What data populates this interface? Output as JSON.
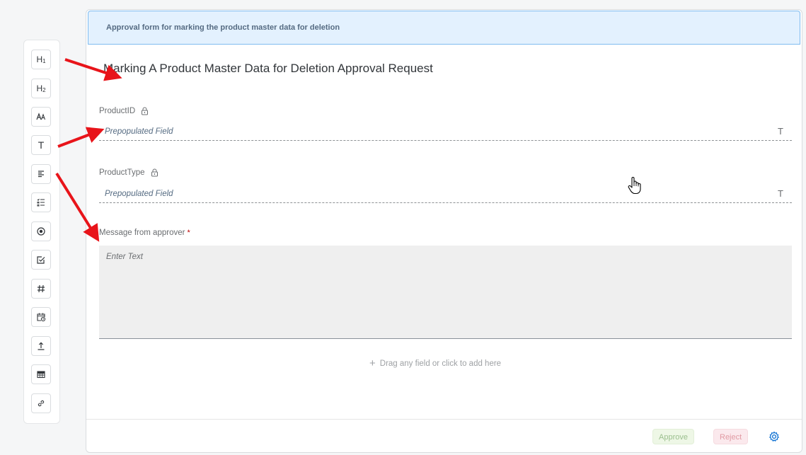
{
  "toolbar": {
    "h1": "H",
    "h1_sub": "1",
    "h2": "H",
    "h2_sub": "2",
    "text_type": "T"
  },
  "form": {
    "banner": "Approval form for marking the product master data for deletion",
    "title": "Marking A Product Master Data for Deletion Approval Request",
    "fields": [
      {
        "label": "ProductID",
        "placeholder": "Prepopulated Field",
        "type_icon": "T"
      },
      {
        "label": "ProductType",
        "placeholder": "Prepopulated Field",
        "type_icon": "T"
      }
    ],
    "message": {
      "label": "Message from approver",
      "required": "*",
      "placeholder": "Enter Text"
    },
    "dropzone": {
      "plus": "+",
      "text": "Drag any field or click to add here"
    }
  },
  "footer": {
    "approve": "Approve",
    "reject": "Reject"
  },
  "colors": {
    "banner_bg": "#e3f1fe",
    "banner_border": "#7fbcf0",
    "approve_text": "#9bbf8e",
    "reject_text": "#e19aa3",
    "accent": "#0a6ed1",
    "annotation_arrow": "#e8141a"
  },
  "icons": [
    "h1-icon",
    "h2-icon",
    "font-icon",
    "text-icon",
    "paragraph-icon",
    "checklist-icon",
    "radio-icon",
    "checkbox-icon",
    "number-icon",
    "date-icon",
    "upload-icon",
    "table-icon",
    "link-icon",
    "lock-icon",
    "gear-icon",
    "hand-cursor-icon"
  ]
}
